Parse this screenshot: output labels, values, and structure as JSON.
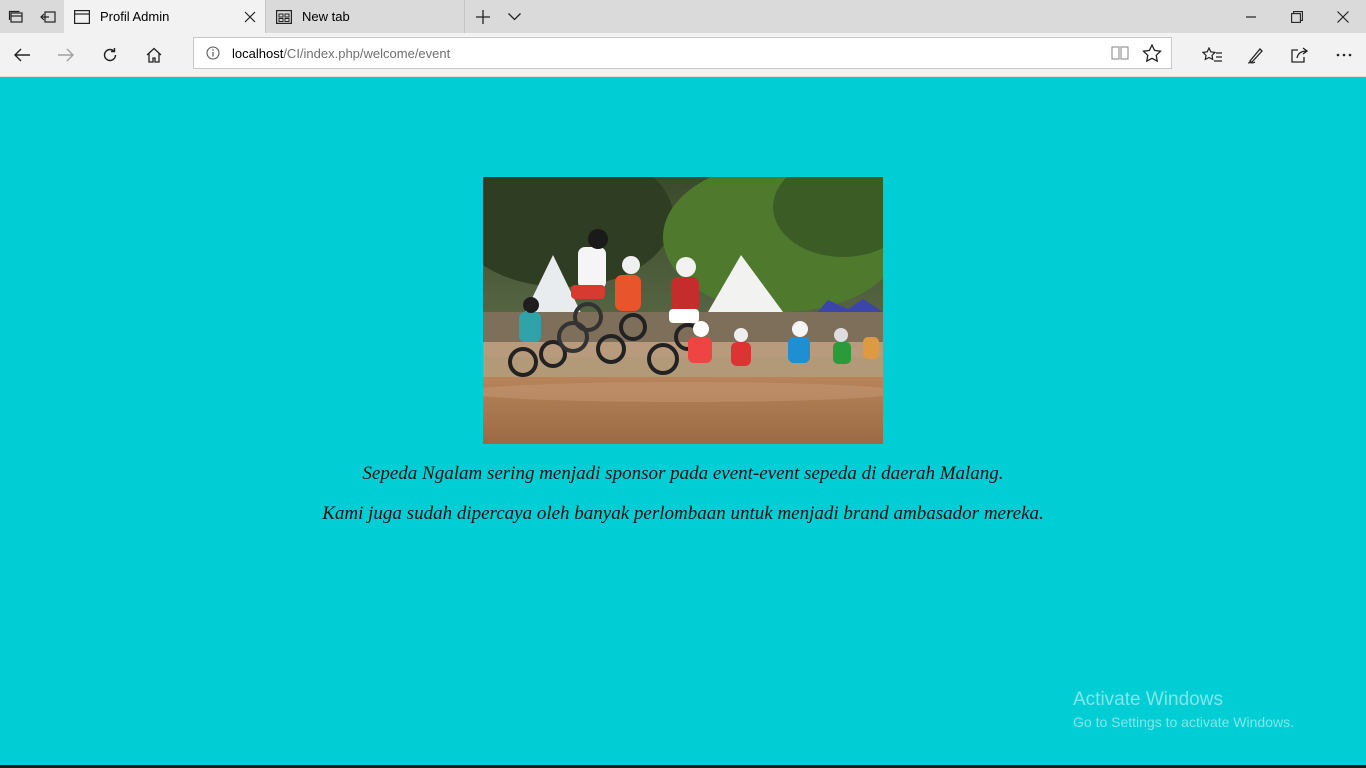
{
  "browser": {
    "tabs": [
      {
        "label": "Profil Admin",
        "active": true
      },
      {
        "label": "New tab",
        "active": false
      }
    ],
    "address": {
      "host": "localhost",
      "path": "/CI/index.php/welcome/event"
    }
  },
  "page": {
    "background": "#00ced4",
    "image_alt": "Motocross riders jumping on a dirt track",
    "captions": [
      "Sepeda Ngalam sering menjadi sponsor pada event-event sepeda di daerah Malang.",
      "Kami juga sudah dipercaya oleh banyak perlombaan untuk menjadi brand ambasador mereka."
    ]
  },
  "watermark": {
    "title": "Activate Windows",
    "subtitle": "Go to Settings to activate Windows."
  },
  "icons": [
    "tab-manager-icon",
    "set-aside-tabs-icon",
    "page-icon",
    "new-tab-page-icon",
    "close-icon",
    "plus-icon",
    "chevron-down-icon",
    "minimize-icon",
    "restore-icon",
    "back-icon",
    "forward-icon",
    "refresh-icon",
    "home-icon",
    "info-icon",
    "reading-view-icon",
    "star-icon",
    "favorites-icon",
    "pen-icon",
    "share-icon",
    "more-icon"
  ]
}
